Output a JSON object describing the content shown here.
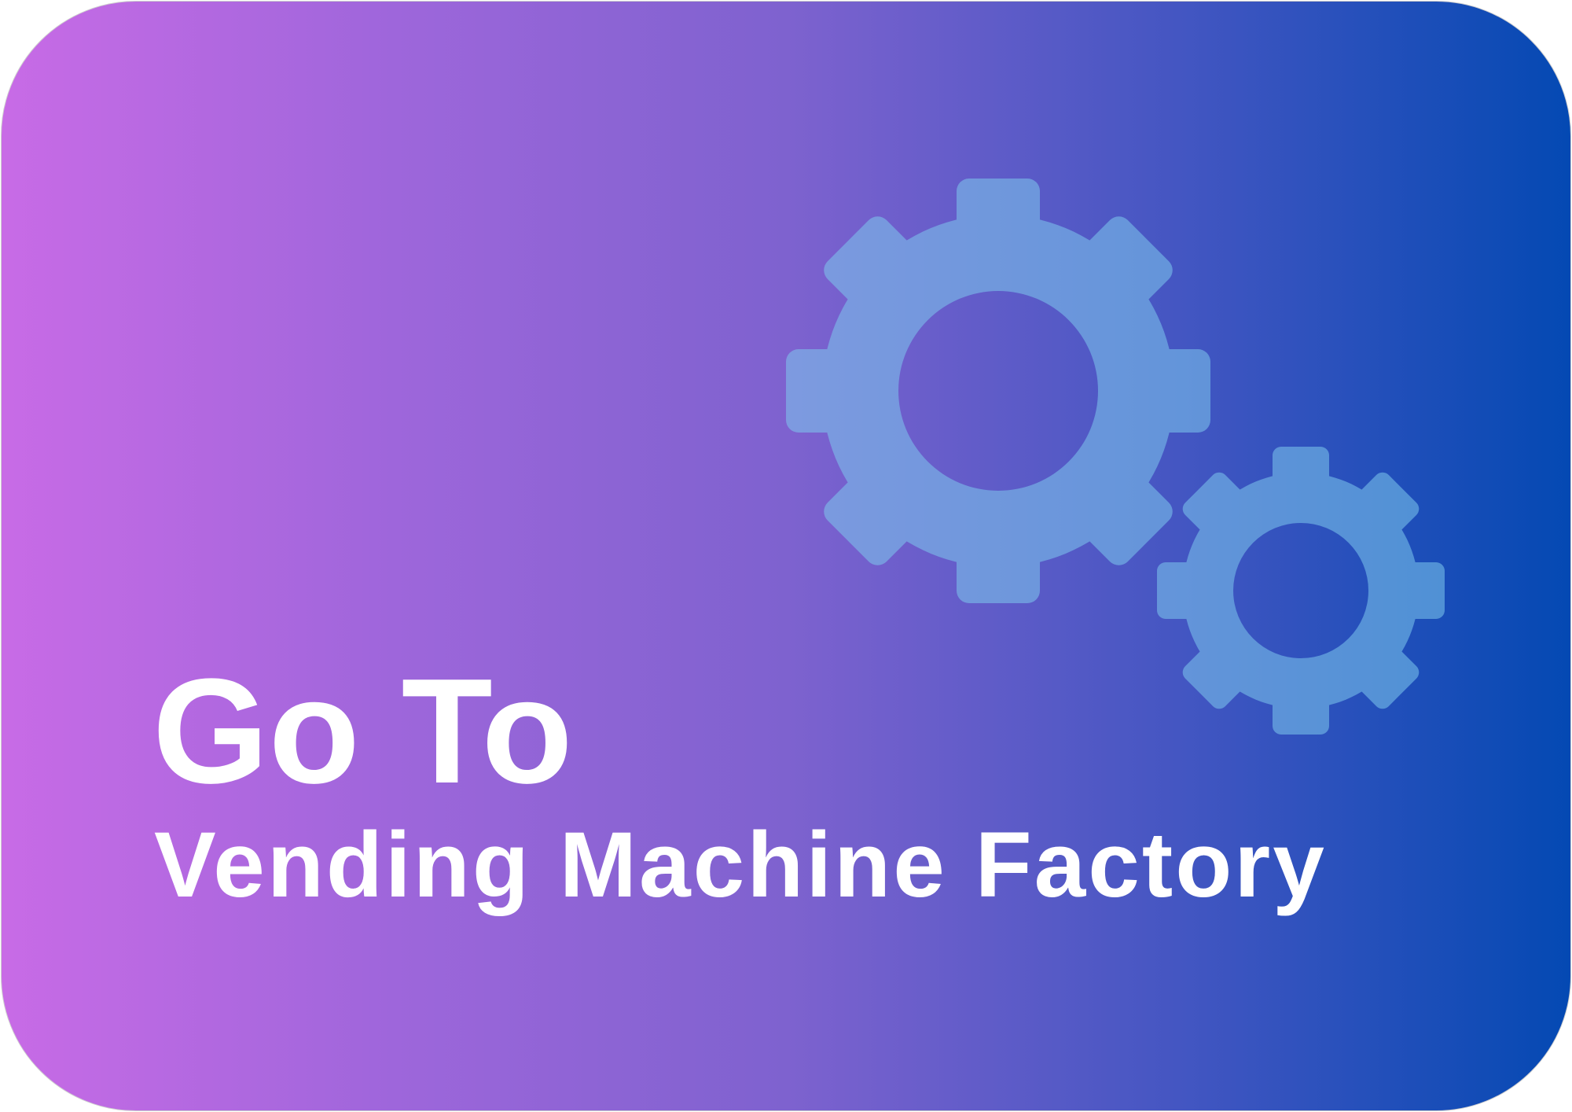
{
  "tile": {
    "title": "Go To",
    "subtitle": "Vending Machine Factory",
    "icons": [
      "gear-icon",
      "gear-icon"
    ]
  },
  "colors": {
    "gradient_start": "#C86BE6",
    "gradient_mid": "#7E62CF",
    "gradient_end": "#0449B3",
    "gear_fill": "#7EC9EE",
    "text": "#FFFFFF"
  }
}
